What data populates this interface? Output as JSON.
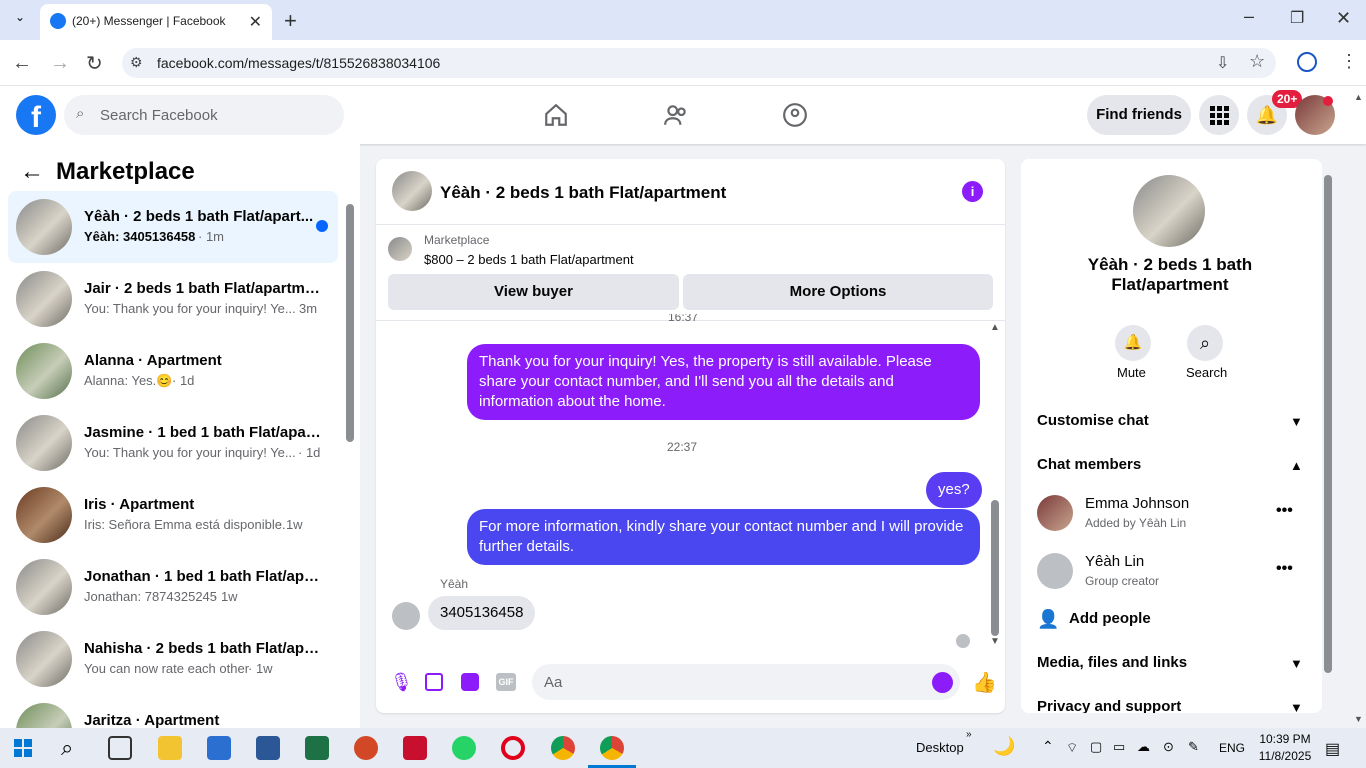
{
  "browser": {
    "tab_title": "(20+) Messenger | Facebook",
    "url": "facebook.com/messages/t/815526838034106"
  },
  "fb": {
    "search_placeholder": "Search Facebook",
    "find_friends": "Find friends",
    "notif_badge": "20+"
  },
  "left": {
    "title": "Marketplace",
    "conversations": [
      {
        "name": "Yêàh · 2 beds 1 bath Flat/apart...",
        "preview": "Yêàh: 3405136458",
        "time": " · 1m"
      },
      {
        "name": "Jair · 2 beds 1 bath Flat/apartment",
        "preview": "You: Thank you for your inquiry! Ye...",
        "time": "3m"
      },
      {
        "name": "Alanna · Apartment",
        "preview": "Alanna: Yes.😊",
        "time": " · 1d"
      },
      {
        "name": "Jasmine · 1 bed 1 bath Flat/apart...",
        "preview": "You: Thank you for your inquiry! Ye...",
        "time": " · 1d"
      },
      {
        "name": "Iris · Apartment",
        "preview": "Iris: Señora Emma está disponible.",
        "time": " · 1w"
      },
      {
        "name": "Jonathan · 1 bed 1 bath Flat/apa...",
        "preview": "Jonathan: 7874325245",
        "time": " · 1w"
      },
      {
        "name": "Nahisha · 2 beds 1 bath Flat/apa...",
        "preview": "You can now rate each other",
        "time": " · 1w"
      },
      {
        "name": "Jaritza · Apartment",
        "preview": "",
        "time": ""
      }
    ]
  },
  "chat": {
    "title": "Yêàh · 2 beds 1 bath Flat/apartment",
    "marketplace_label": "Marketplace",
    "listing": "$800 – 2 beds 1 bath Flat/apartment",
    "view_buyer": "View buyer",
    "more_options": "More Options",
    "msg1": "Thank you for your inquiry! Yes, the property is still available. Please share your contact number, and I'll send you all the details and information about the home.",
    "time1": "22:37",
    "msg2": "yes?",
    "msg3": "For more information, kindly share your contact number and I will provide further details.",
    "sender": "Yêàh",
    "msg4": "3405136458",
    "input_placeholder": "Aa",
    "time_partial": "16:37"
  },
  "right": {
    "name": "Yêàh · 2 beds 1 bath Flat/apartment",
    "mute": "Mute",
    "search": "Search",
    "customise": "Customise chat",
    "members_header": "Chat members",
    "members": [
      {
        "name": "Emma Johnson",
        "role": "Added by Yêàh Lin"
      },
      {
        "name": "Yêàh Lin",
        "role": "Group creator"
      }
    ],
    "add_people": "Add people",
    "media": "Media, files and links",
    "privacy": "Privacy and support"
  },
  "taskbar": {
    "desktop": "Desktop",
    "lang": "ENG",
    "time": "10:39 PM",
    "date": "11/8/2025"
  },
  "colors": {
    "fb_blue": "#1877f2",
    "bubble_purple": "#8c1cf9",
    "bubble_blue": "#4a46f0"
  }
}
